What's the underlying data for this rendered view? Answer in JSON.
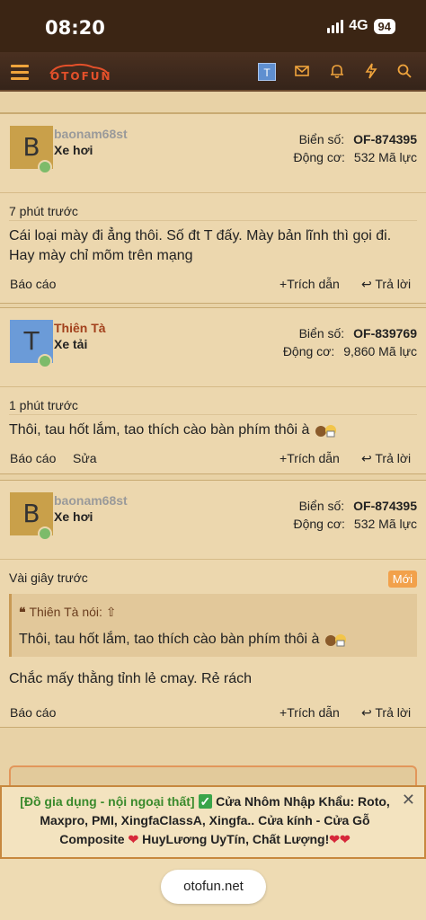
{
  "status": {
    "time": "08:20",
    "network": "4G",
    "battery": "94"
  },
  "nav": {
    "logo": "OTOFUN",
    "avatar_letter": "T"
  },
  "posts": [
    {
      "avatar_letter": "B",
      "avatar_color": "#c9a04a",
      "username": "baonam68st",
      "username_color": "#9a9a9a",
      "user_title": "Xe hơi",
      "plate_label": "Biển số:",
      "plate": "OF-874395",
      "engine_label": "Động cơ:",
      "engine": "532 Mã lực",
      "time": "7 phút trước",
      "body": "Cái loại mày đi ẳng thôi. Số đt T đấy. Mày bản lĩnh thì gọi đi. Hay mày chỉ mõm trên mạng",
      "report": "Báo cáo",
      "quote_action": "Trích dẫn",
      "reply": "Trả lời"
    },
    {
      "avatar_letter": "T",
      "avatar_color": "#6b9bd8",
      "username": "Thiên Tà",
      "username_color": "#a2401c",
      "user_title": "Xe tải",
      "plate_label": "Biển số:",
      "plate": "OF-839769",
      "engine_label": "Động cơ:",
      "engine": "9,860 Mã lực",
      "time": "1 phút trước",
      "body": "Thôi, tau hốt lắm, tao thích cào bàn phím thôi à",
      "report": "Báo cáo",
      "edit": "Sửa",
      "quote_action": "Trích dẫn",
      "reply": "Trả lời"
    },
    {
      "avatar_letter": "B",
      "avatar_color": "#c9a04a",
      "username": "baonam68st",
      "username_color": "#9a9a9a",
      "user_title": "Xe hơi",
      "plate_label": "Biển số:",
      "plate": "OF-874395",
      "engine_label": "Động cơ:",
      "engine": "532 Mã lực",
      "time": "Vài giây trước",
      "new_badge": "Mới",
      "quote_author": "Thiên Tà nói:",
      "quote_text": "Thôi, tau hốt lắm, tao thích cào bàn phím thôi à",
      "body": "Chắc mấy thằng tỉnh lẻ cmay. Rẻ rách",
      "report": "Báo cáo",
      "quote_action": "Trích dẫn",
      "reply": "Trả lời"
    }
  ],
  "ad": {
    "tag": "[Đồ gia dụng - nội ngoại thất]",
    "text": "Cửa Nhôm Nhập Khẩu: Roto, Maxpro, PMI, XingfaClassA, Xingfa.. Cửa kính - Cửa Gỗ Composite",
    "text2": "HuyLương UyTín, Chất Lượng!"
  },
  "browser": {
    "url": "otofun.net"
  },
  "colors": {
    "accent": "#f0a43c",
    "nav_bg": "#3b2514",
    "page_bg": "#e8d2a6",
    "ad_tag": "#3a8a2c"
  }
}
